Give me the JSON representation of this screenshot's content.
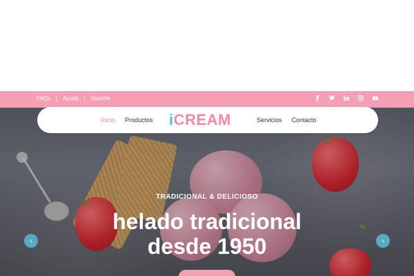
{
  "topbar": {
    "links": [
      "FAQs",
      "Ayuda",
      "Soporte"
    ],
    "separator": "|",
    "social_icons": [
      "facebook-icon",
      "twitter-icon",
      "linkedin-icon",
      "instagram-icon",
      "youtube-icon"
    ]
  },
  "nav": {
    "left_items": [
      "Inicio",
      "Productos"
    ],
    "right_items": [
      "Servicios",
      "Contacto"
    ],
    "active_item": "Inicio",
    "logo_i": "i",
    "logo_rest": "CREAM"
  },
  "hero": {
    "eyebrow": "TRADICIONAL & DELICIOSO",
    "headline_line1": "helado tradicional",
    "headline_line2": "desde 1950",
    "prev_icon": "‹",
    "next_icon": "›"
  },
  "colors": {
    "brand_pink": "#f3a0b4",
    "active_pink": "#f08aa6",
    "logo_blue": "#3ec5dc",
    "arrow_blue": "#5dbad7"
  }
}
